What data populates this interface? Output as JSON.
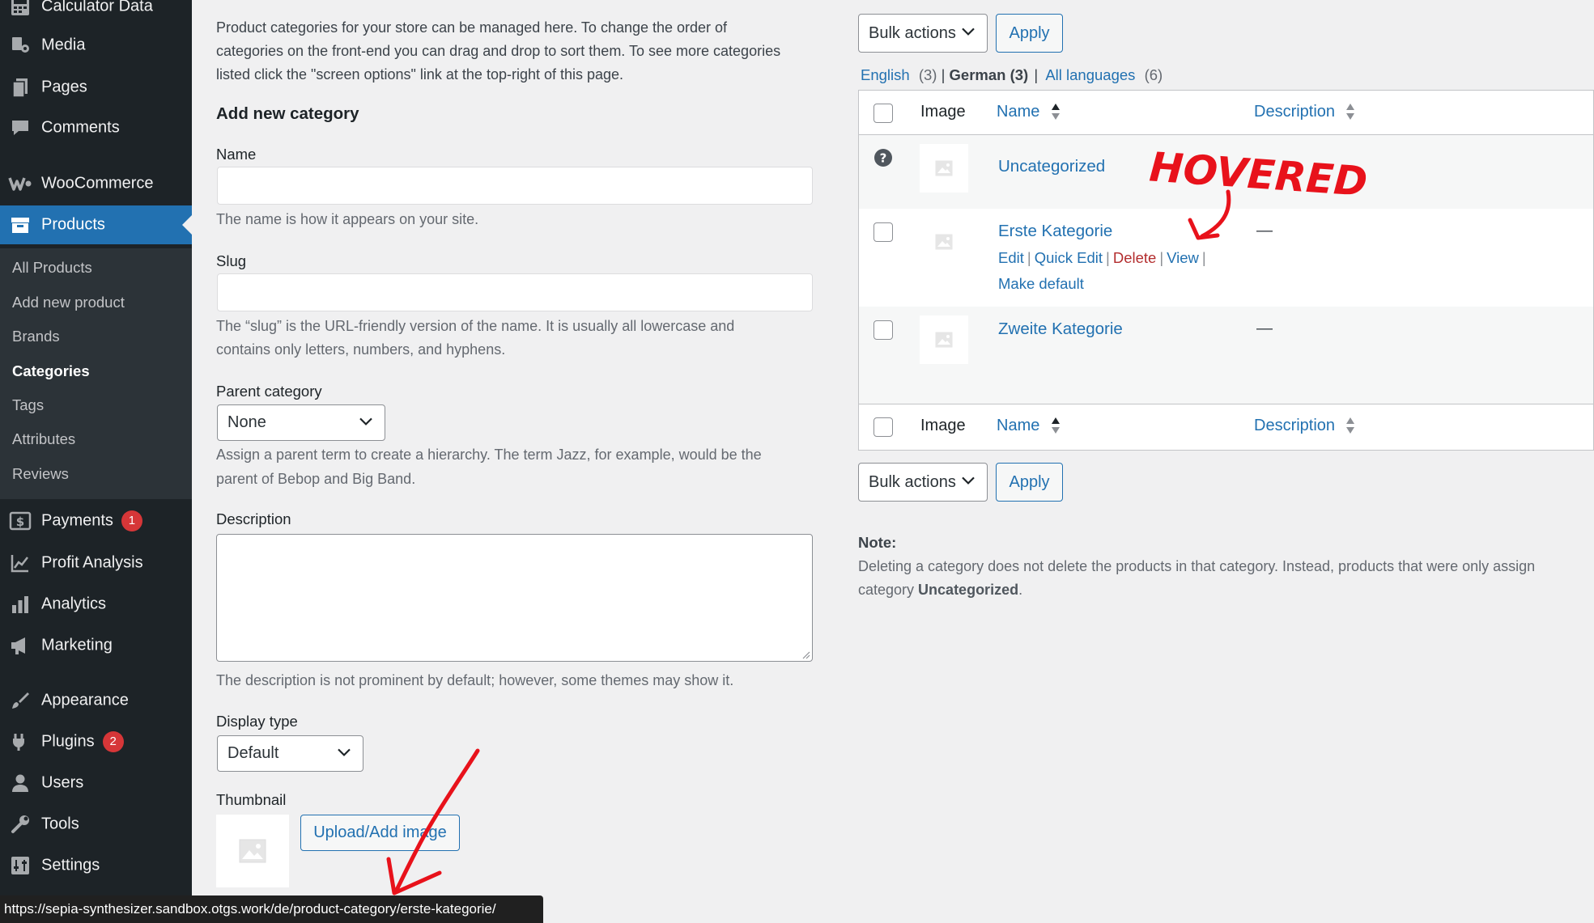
{
  "sidebar": {
    "items": [
      {
        "label": "Calculator Data",
        "icon": "calculator-icon"
      },
      {
        "label": "Media",
        "icon": "media-icon"
      },
      {
        "label": "Pages",
        "icon": "pages-icon"
      },
      {
        "label": "Comments",
        "icon": "comments-icon"
      },
      {
        "label": "WooCommerce",
        "icon": "woocommerce-icon"
      },
      {
        "label": "Products",
        "icon": "products-icon"
      },
      {
        "label": "Payments",
        "icon": "payments-icon",
        "badge": "1"
      },
      {
        "label": "Profit Analysis",
        "icon": "profit-analysis-icon"
      },
      {
        "label": "Analytics",
        "icon": "analytics-icon"
      },
      {
        "label": "Marketing",
        "icon": "marketing-icon"
      },
      {
        "label": "Appearance",
        "icon": "appearance-icon"
      },
      {
        "label": "Plugins",
        "icon": "plugins-icon",
        "badge": "2"
      },
      {
        "label": "Users",
        "icon": "users-icon"
      },
      {
        "label": "Tools",
        "icon": "tools-icon"
      },
      {
        "label": "Settings",
        "icon": "settings-icon"
      }
    ],
    "submenu": [
      "All Products",
      "Add new product",
      "Brands",
      "Categories",
      "Tags",
      "Attributes",
      "Reviews"
    ]
  },
  "form": {
    "intro_lines": [
      "Product categories for your store can be managed here. To change the order of",
      "categories on the front-end you can drag and drop to sort them. To see more categories",
      "listed click the \"screen options\" link at the top-right of this page."
    ],
    "heading": "Add new category",
    "name_label": "Name",
    "name_help": "The name is how it appears on your site.",
    "slug_label": "Slug",
    "slug_help_lines": [
      "The “slug” is the URL-friendly version of the name. It is usually all lowercase and",
      "contains only letters, numbers, and hyphens."
    ],
    "parent_label": "Parent category",
    "parent_value": "None",
    "parent_help_lines": [
      "Assign a parent term to create a hierarchy. The term Jazz, for example, would be the",
      "parent of Bebop and Big Band."
    ],
    "description_label": "Description",
    "description_help": "The description is not prominent by default; however, some themes may show it.",
    "display_type_label": "Display type",
    "display_type_value": "Default",
    "thumbnail_label": "Thumbnail",
    "upload_button": "Upload/Add image"
  },
  "list": {
    "bulk_actions": "Bulk actions",
    "apply": "Apply",
    "languages": [
      {
        "label": "English",
        "count": "(3)"
      },
      {
        "label": "German",
        "count": "(3)"
      },
      {
        "label": "All languages",
        "count": "(6)"
      }
    ],
    "columns": {
      "image": "Image",
      "name": "Name",
      "description": "Description"
    },
    "rows": [
      {
        "name": "Uncategorized",
        "description": ""
      },
      {
        "name": "Erste Kategorie",
        "description": "—"
      },
      {
        "name": "Zweite Kategorie",
        "description": "—"
      }
    ],
    "row_actions": {
      "edit": "Edit",
      "quick_edit": "Quick Edit",
      "delete": "Delete",
      "view": "View",
      "make_default": "Make default"
    },
    "note_title": "Note:",
    "note_text_line1": "Deleting a category does not delete the products in that category. Instead, products that were only assign",
    "note_text_line2_prefix": "category ",
    "note_text_line2_bold": "Uncategorized",
    "note_text_line2_suffix": "."
  },
  "annotation": {
    "text": "HOVERED",
    "color": "#e8121b"
  },
  "statusbar": {
    "url": "https://sepia-synthesizer.sandbox.otgs.work/de/product-category/erste-kategorie/"
  },
  "colors": {
    "accent": "#2271b1",
    "sidebar": "#1d2327",
    "delete": "#b32d2e",
    "badge": "#d63638"
  }
}
